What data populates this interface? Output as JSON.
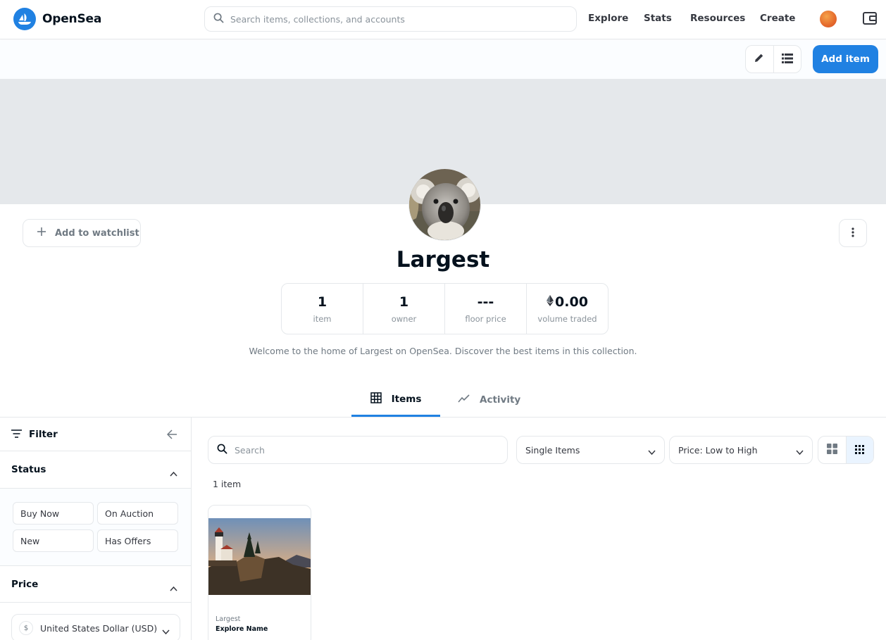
{
  "nav": {
    "brand": "OpenSea",
    "search_placeholder": "Search items, collections, and accounts",
    "links": [
      "Explore",
      "Stats",
      "Resources",
      "Create"
    ]
  },
  "actions": {
    "add_item_label": "Add item"
  },
  "collection": {
    "name": "Largest",
    "watchlist_label": "Add to watchlist",
    "description": "Welcome to the home of Largest on OpenSea. Discover the best items in this collection.",
    "stats": [
      {
        "value": "1",
        "label": "item"
      },
      {
        "value": "1",
        "label": "owner"
      },
      {
        "value": "---",
        "label": "floor price"
      },
      {
        "value": "0.00",
        "label": "volume traded",
        "currency_icon": "ethereum-icon"
      }
    ]
  },
  "tabs": [
    {
      "label": "Items",
      "icon": "grid-icon",
      "active": true
    },
    {
      "label": "Activity",
      "icon": "trend-icon",
      "active": false
    }
  ],
  "sidebar": {
    "filter_label": "Filter",
    "status_label": "Status",
    "status_options": [
      "Buy Now",
      "On Auction",
      "New",
      "Has Offers"
    ],
    "price_label": "Price",
    "currency": {
      "symbol": "$",
      "label": "United States Dollar (USD)"
    }
  },
  "main": {
    "search_placeholder": "Search",
    "item_type": "Single Items",
    "sort": "Price: Low to High",
    "count_label": "1 item",
    "items": [
      {
        "collection": "Largest",
        "name": "Explore Name"
      }
    ]
  },
  "colors": {
    "accent": "#2081e2",
    "banner": "#e5e8eb",
    "border": "#e5e8eb",
    "text": "#04111d",
    "muted": "#707a83"
  }
}
